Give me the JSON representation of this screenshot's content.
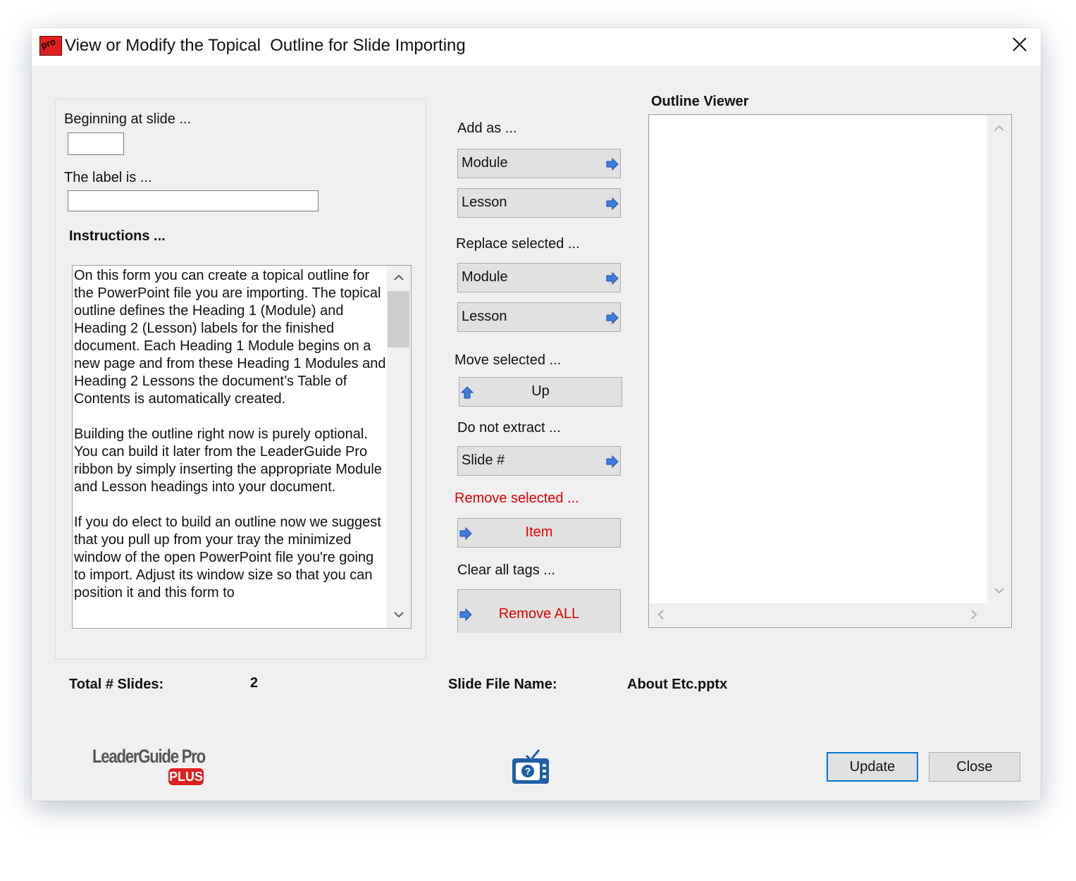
{
  "window": {
    "title": "View or Modify the Topical  Outline for Slide Importing",
    "app_icon_text": "pro"
  },
  "left": {
    "beginning_label": "Beginning at slide ...",
    "beginning_value": "",
    "label_label": "The label is ...",
    "label_value": "",
    "instructions_heading": "Instructions ...",
    "instructions": [
      "On this form you can create a topical outline for the PowerPoint file you are importing. The topical outline defines the Heading 1 (Module) and Heading 2 (Lesson) labels for the finished document.  Each Heading 1 Module begins on a new page and from these Heading 1 Modules and Heading 2 Lessons the document’s Table of Contents is automatically created.",
      "Building the outline right now is purely optional. You can build it later from the LeaderGuide Pro ribbon by simply inserting the appropriate Module and Lesson headings into your document.",
      "If you do elect to build an outline now we suggest that you pull up from your tray the minimized window of the open PowerPoint file you're going to import. Adjust its window size so that you can position it and this form to"
    ]
  },
  "middle": {
    "add_as_label": "Add as ...",
    "add_module": "Module",
    "add_lesson": "Lesson",
    "replace_label": "Replace selected ...",
    "replace_module": "Module",
    "replace_lesson": "Lesson",
    "move_label": "Move selected ...",
    "move_up": "Up",
    "do_not_extract_label": "Do not extract ...",
    "slide_number": "Slide #",
    "remove_label": "Remove selected ...",
    "remove_item": "Item",
    "clear_label": "Clear all tags ...",
    "remove_all": "Remove ALL"
  },
  "outline": {
    "title": "Outline Viewer"
  },
  "footer": {
    "total_slides_label": "Total # Slides:",
    "total_slides_value": "2",
    "file_name_label": "Slide File Name:",
    "file_name_value": "About Etc.pptx",
    "logo_text": "LeaderGuide Pro",
    "logo_badge": "PLUS",
    "update": "Update",
    "close": "Close"
  },
  "colors": {
    "accent_red": "#e00000",
    "arrow_blue": "#3f7be0",
    "focus_border": "#0078d7"
  },
  "icons": [
    "app-logo-icon",
    "close-icon",
    "right-arrow-icon",
    "up-arrow-icon",
    "help-video-icon"
  ]
}
